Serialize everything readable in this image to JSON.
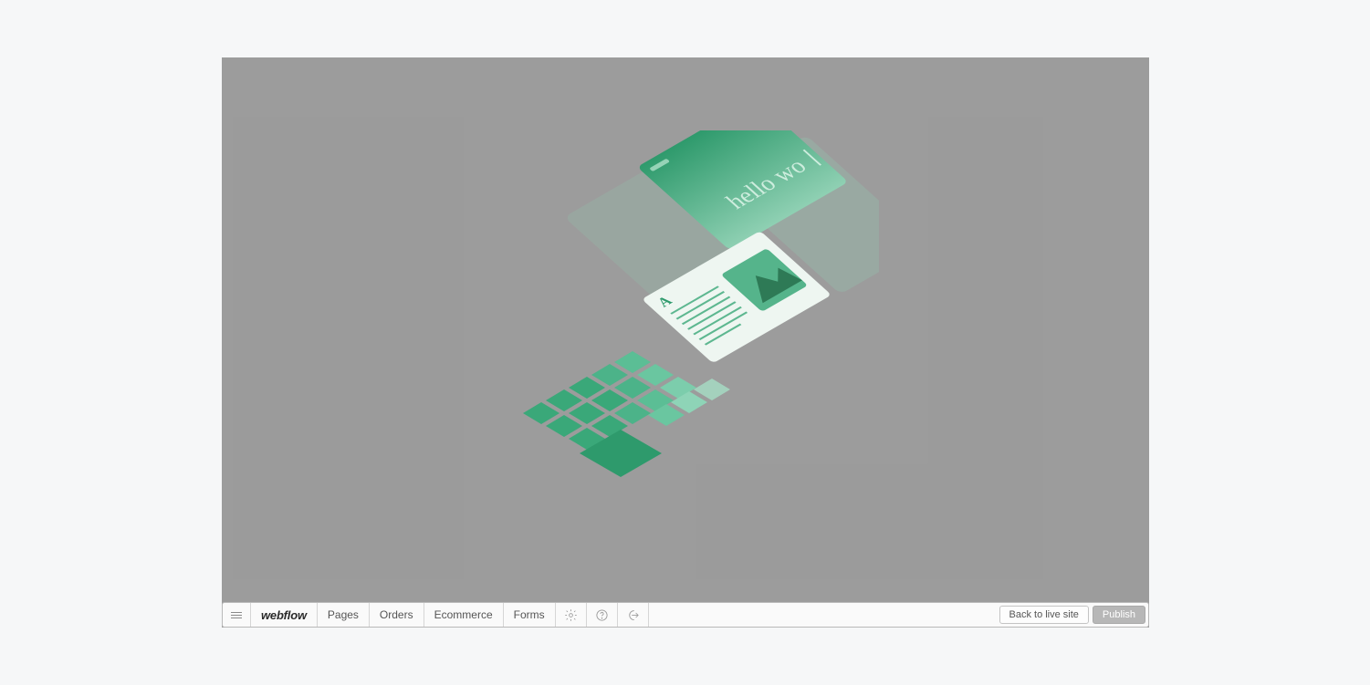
{
  "brand": "webflow",
  "nav": {
    "pages": "Pages",
    "orders": "Orders",
    "ecommerce": "Ecommerce",
    "forms": "Forms"
  },
  "actions": {
    "back": "Back to live site",
    "publish": "Publish"
  },
  "illustration": {
    "typed_text": "hello wo",
    "letter": "A"
  },
  "colors": {
    "accent": "#3aa879",
    "accent_light": "#8fd0b3"
  }
}
